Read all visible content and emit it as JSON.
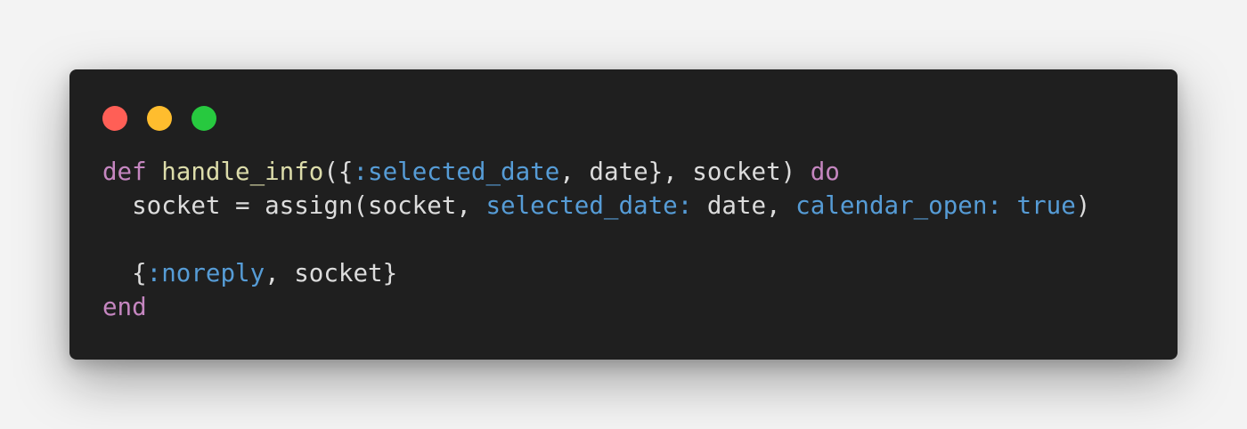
{
  "colors": {
    "page_background": "#f3f3f3",
    "window_background": "#1f1f1f",
    "close": "#ff5f56",
    "minimize": "#ffbd2e",
    "maximize": "#27c93f",
    "keyword": "#c586c0",
    "function": "#dcdcaa",
    "atom": "#569cd6",
    "text": "#dcdcdc"
  },
  "code": {
    "lines": [
      {
        "tokens": [
          {
            "text": "def",
            "kind": "kw"
          },
          {
            "text": " ",
            "kind": "plain"
          },
          {
            "text": "handle_info",
            "kind": "fn"
          },
          {
            "text": "({",
            "kind": "plain"
          },
          {
            "text": ":selected_date",
            "kind": "atom"
          },
          {
            "text": ", date}, socket) ",
            "kind": "plain"
          },
          {
            "text": "do",
            "kind": "kw"
          }
        ]
      },
      {
        "tokens": [
          {
            "text": "  socket = assign(socket, ",
            "kind": "plain"
          },
          {
            "text": "selected_date:",
            "kind": "atom"
          },
          {
            "text": " date, ",
            "kind": "plain"
          },
          {
            "text": "calendar_open:",
            "kind": "atom"
          },
          {
            "text": " ",
            "kind": "plain"
          },
          {
            "text": "true",
            "kind": "atom"
          },
          {
            "text": ")",
            "kind": "plain"
          }
        ]
      },
      {
        "tokens": []
      },
      {
        "tokens": [
          {
            "text": "  {",
            "kind": "plain"
          },
          {
            "text": ":noreply",
            "kind": "atom"
          },
          {
            "text": ", socket}",
            "kind": "plain"
          }
        ]
      },
      {
        "tokens": [
          {
            "text": "end",
            "kind": "kw"
          }
        ]
      }
    ]
  }
}
